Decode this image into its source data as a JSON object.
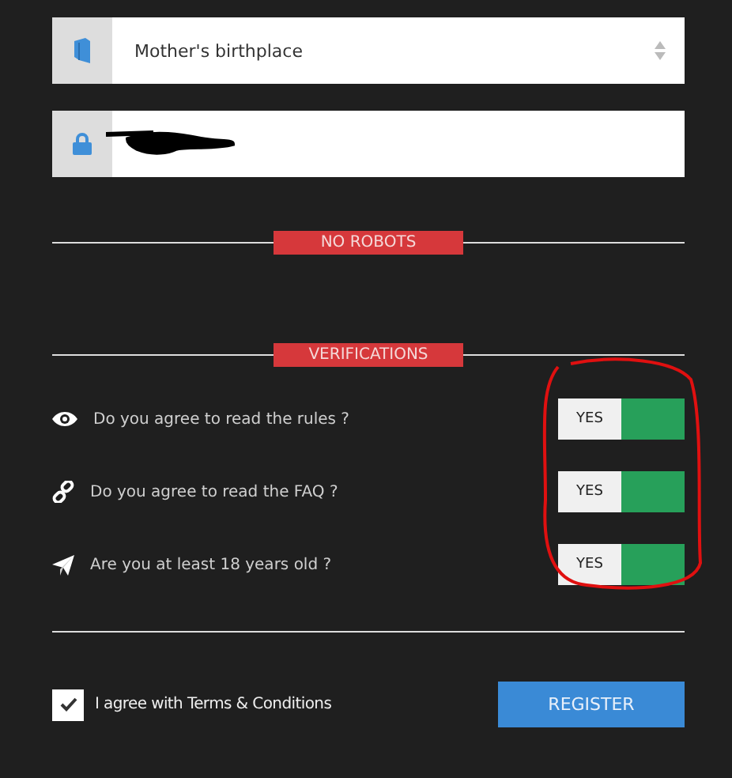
{
  "security_question": {
    "value": "Mother's birthplace"
  },
  "answer": {
    "redacted": true
  },
  "sections": [
    "NO ROBOTS",
    "VERIFICATIONS"
  ],
  "verifications": [
    {
      "question": "Do you agree to read the rules ?",
      "toggle_label": "YES",
      "on": true
    },
    {
      "question": "Do you agree to read the FAQ ?",
      "toggle_label": "YES",
      "on": true
    },
    {
      "question": "Are you at least 18 years old ?",
      "toggle_label": "YES",
      "on": true
    }
  ],
  "terms": {
    "label": "I agree with Terms & Conditions",
    "checked": true
  },
  "register_button": "REGISTER",
  "annotation": {
    "kind": "circle"
  }
}
